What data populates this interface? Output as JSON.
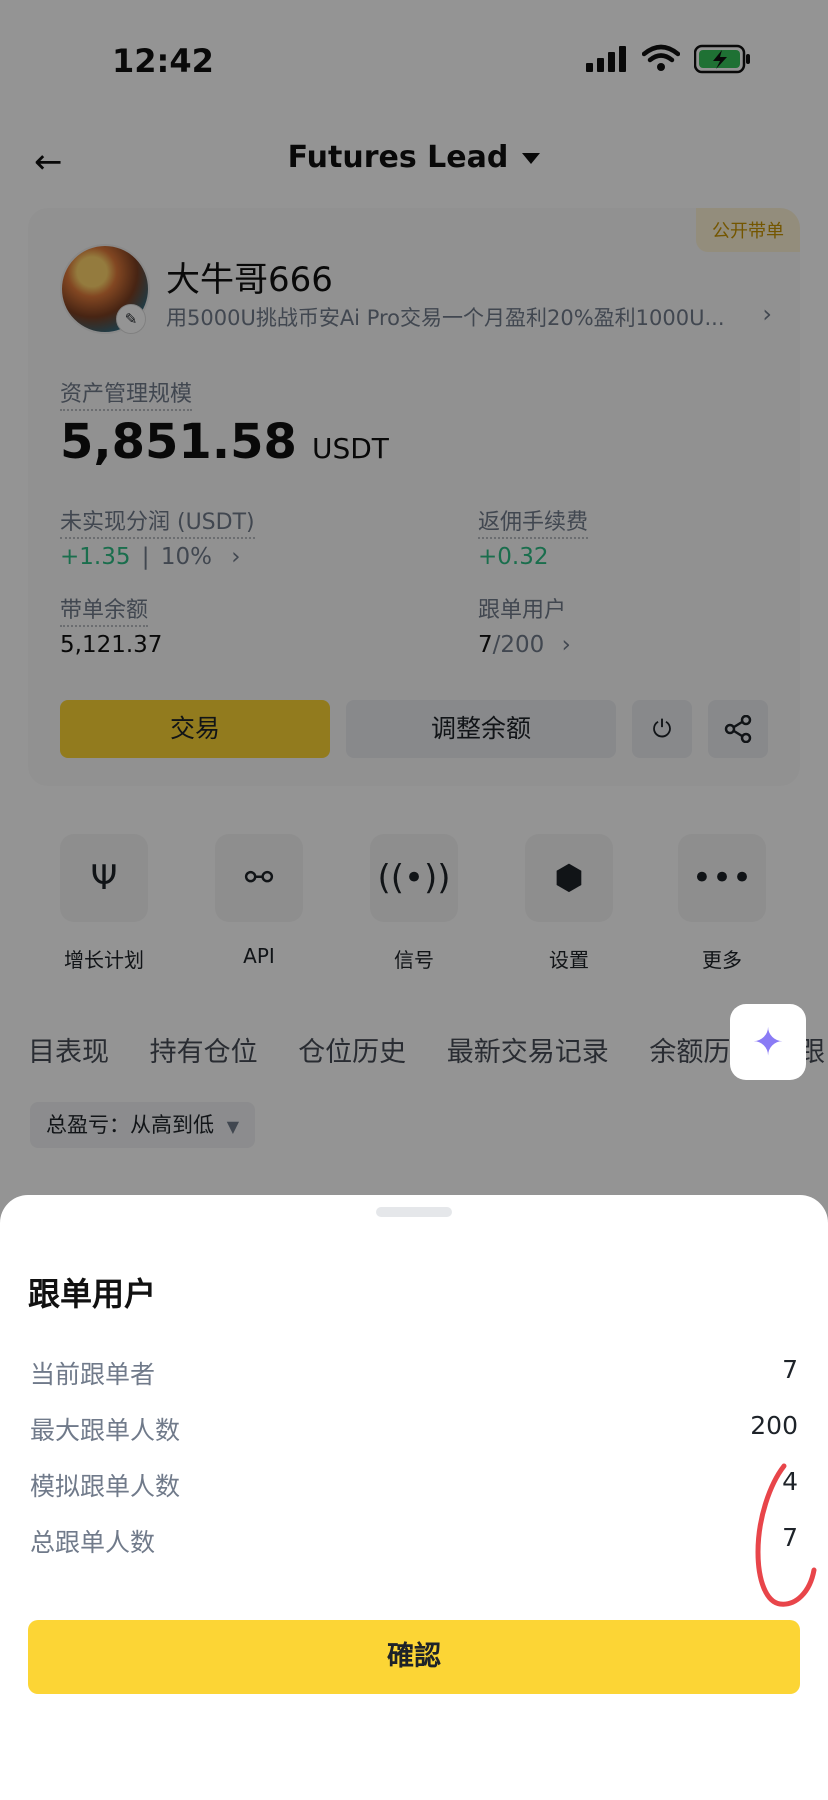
{
  "status_bar": {
    "time": "12:42"
  },
  "header": {
    "title": "Futures Lead"
  },
  "profile": {
    "tag": "公开带单",
    "name": "大牛哥666",
    "bio": "用5000U挑战币安Ai Pro交易一个月盈利20%盈利1000U..."
  },
  "stats": {
    "aum_label": "资产管理规模",
    "aum_value": "5,851.58",
    "aum_unit": "USDT",
    "unrealized_label": "未实现分润 (USDT)",
    "unrealized_value": "+1.35",
    "unrealized_sep": "|",
    "unrealized_pct": "10%",
    "rebate_label": "返佣手续费",
    "rebate_value": "+0.32",
    "balance_label": "带单余额",
    "balance_value": "5,121.37",
    "followers_label": "跟单用户",
    "followers_current": "7",
    "followers_max": "/200"
  },
  "actions": {
    "trade": "交易",
    "adjust": "调整余额"
  },
  "quick_actions": [
    {
      "label": "增长计划",
      "icon": "sprout-icon"
    },
    {
      "label": "API",
      "icon": "plug-icon"
    },
    {
      "label": "信号",
      "icon": "signal-icon"
    },
    {
      "label": "设置",
      "icon": "settings-hex-icon"
    },
    {
      "label": "更多",
      "icon": "more-icon"
    }
  ],
  "tabs": [
    "目表现",
    "持有仓位",
    "仓位历史",
    "最新交易记录",
    "余额历史",
    "跟"
  ],
  "sort": {
    "label": "总盈亏：从高到低"
  },
  "sheet": {
    "title": "跟单用户",
    "rows": [
      {
        "label": "当前跟单者",
        "value": "7"
      },
      {
        "label": "最大跟单人数",
        "value": "200"
      },
      {
        "label": "模拟跟单人数",
        "value": "4"
      },
      {
        "label": "总跟单人数",
        "value": "7"
      }
    ],
    "confirm": "確認"
  },
  "colors": {
    "accent": "#FCD535",
    "positive": "#2EBD85",
    "annotation": "#E8454A"
  }
}
